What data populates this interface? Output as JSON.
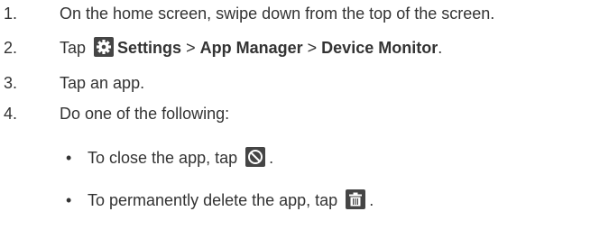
{
  "steps": [
    {
      "number": "1.",
      "text": "On the home screen, swipe down from the top of the screen."
    },
    {
      "number": "2.",
      "prefix": "Tap",
      "settings": "Settings",
      "sep1": ">",
      "app_manager": "App Manager",
      "sep2": ">",
      "device_monitor": "Device Monitor",
      "end": "."
    },
    {
      "number": "3.",
      "text": "Tap an app."
    },
    {
      "number": "4.",
      "text": "Do one of the following:"
    }
  ],
  "bullets": [
    {
      "text": "To close the app, tap",
      "end": ".",
      "icon": "block-icon"
    },
    {
      "text": "To permanently delete the app, tap",
      "end": ".",
      "icon": "trash-icon"
    }
  ],
  "bullet_char": "•",
  "colors": {
    "text": "#333333",
    "icon_bg": "#454545",
    "icon_fg": "#ffffff"
  }
}
